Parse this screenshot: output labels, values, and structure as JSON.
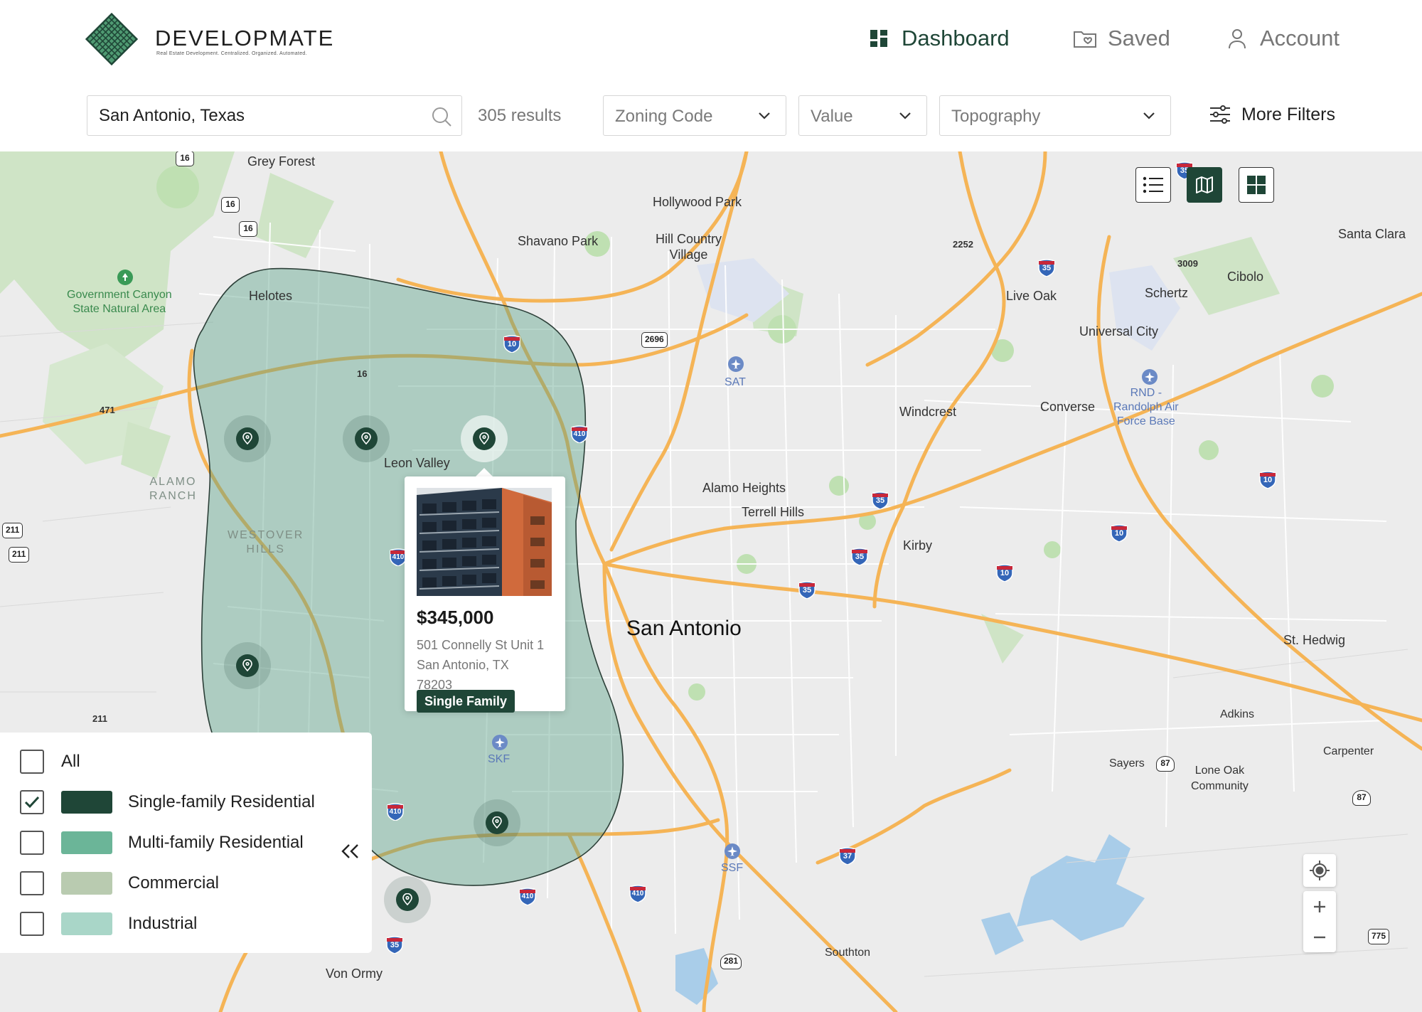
{
  "app": {
    "brand": "DEVELOPMATE",
    "tagline": "Real Estate Development. Centralized. Organized. Automated.",
    "accent_color": "#1f4637"
  },
  "nav": {
    "dashboard": "Dashboard",
    "saved": "Saved",
    "account": "Account"
  },
  "filters": {
    "search_value": "San Antonio, Texas",
    "results": "305 results",
    "zoning": "Zoning Code",
    "value": "Value",
    "topography": "Topography",
    "more": "More Filters"
  },
  "view_toggle": {
    "options": [
      "list-icon",
      "map-icon",
      "grid-icon"
    ],
    "selected": "map"
  },
  "map": {
    "labels": {
      "grey_forest": "Grey Forest",
      "hollywood_park": "Hollywood Park",
      "shavano_park": "Shavano Park",
      "hill_country_village": "Hill Country\nVillage",
      "santa_clara": "Santa Clara",
      "cibolo": "Cibolo",
      "schertz": "Schertz",
      "live_oak": "Live Oak",
      "universal_city": "Universal City",
      "gov_canyon": "Government Canyon\nState Natural Area",
      "helotes": "Helotes",
      "sat": "SAT",
      "rnd": "RND -\nRandolph Air\nForce Base",
      "converse": "Converse",
      "windcrest": "Windcrest",
      "leon_valley": "Leon Valley",
      "alamo_ranch": "ALAMO\nRANCH",
      "westover_hills": "WESTOVER\nHILLS",
      "alamo_heights": "Alamo Heights",
      "terrell_hills": "Terrell Hills",
      "kirby": "Kirby",
      "san_antonio": "San Antonio",
      "st_hedwig": "St. Hedwig",
      "adkins": "Adkins",
      "carpenter": "Carpenter",
      "sayers": "Sayers",
      "lone_oak": "Lone Oak\nCommunity",
      "skf": "SKF",
      "ssf": "SSF",
      "southton": "Southton",
      "von_ormy": "Von Ormy"
    },
    "road_numbers": [
      "16",
      "16",
      "16",
      "16",
      "471",
      "211",
      "211",
      "211",
      "2696",
      "2252",
      "3009",
      "281",
      "775",
      "87",
      "87"
    ],
    "interstates": [
      "10",
      "410",
      "410",
      "410",
      "410",
      "410",
      "35",
      "35",
      "35",
      "35",
      "35",
      "10",
      "10",
      "10",
      "37",
      "35"
    ]
  },
  "property_card": {
    "price": "$345,000",
    "address_line1": "501 Connelly St Unit 1",
    "address_line2": "San Antonio, TX",
    "address_line3": "78203",
    "type": "Single Family"
  },
  "legend": {
    "items": [
      {
        "label": "All",
        "checked": false,
        "color": null
      },
      {
        "label": "Single-family Residential",
        "checked": true,
        "color": "#1f4637"
      },
      {
        "label": "Multi-family Residential",
        "checked": false,
        "color": "#6bb598"
      },
      {
        "label": "Commercial",
        "checked": false,
        "color": "#b9cbb0"
      },
      {
        "label": "Industrial",
        "checked": false,
        "color": "#a9d6c8"
      }
    ]
  }
}
